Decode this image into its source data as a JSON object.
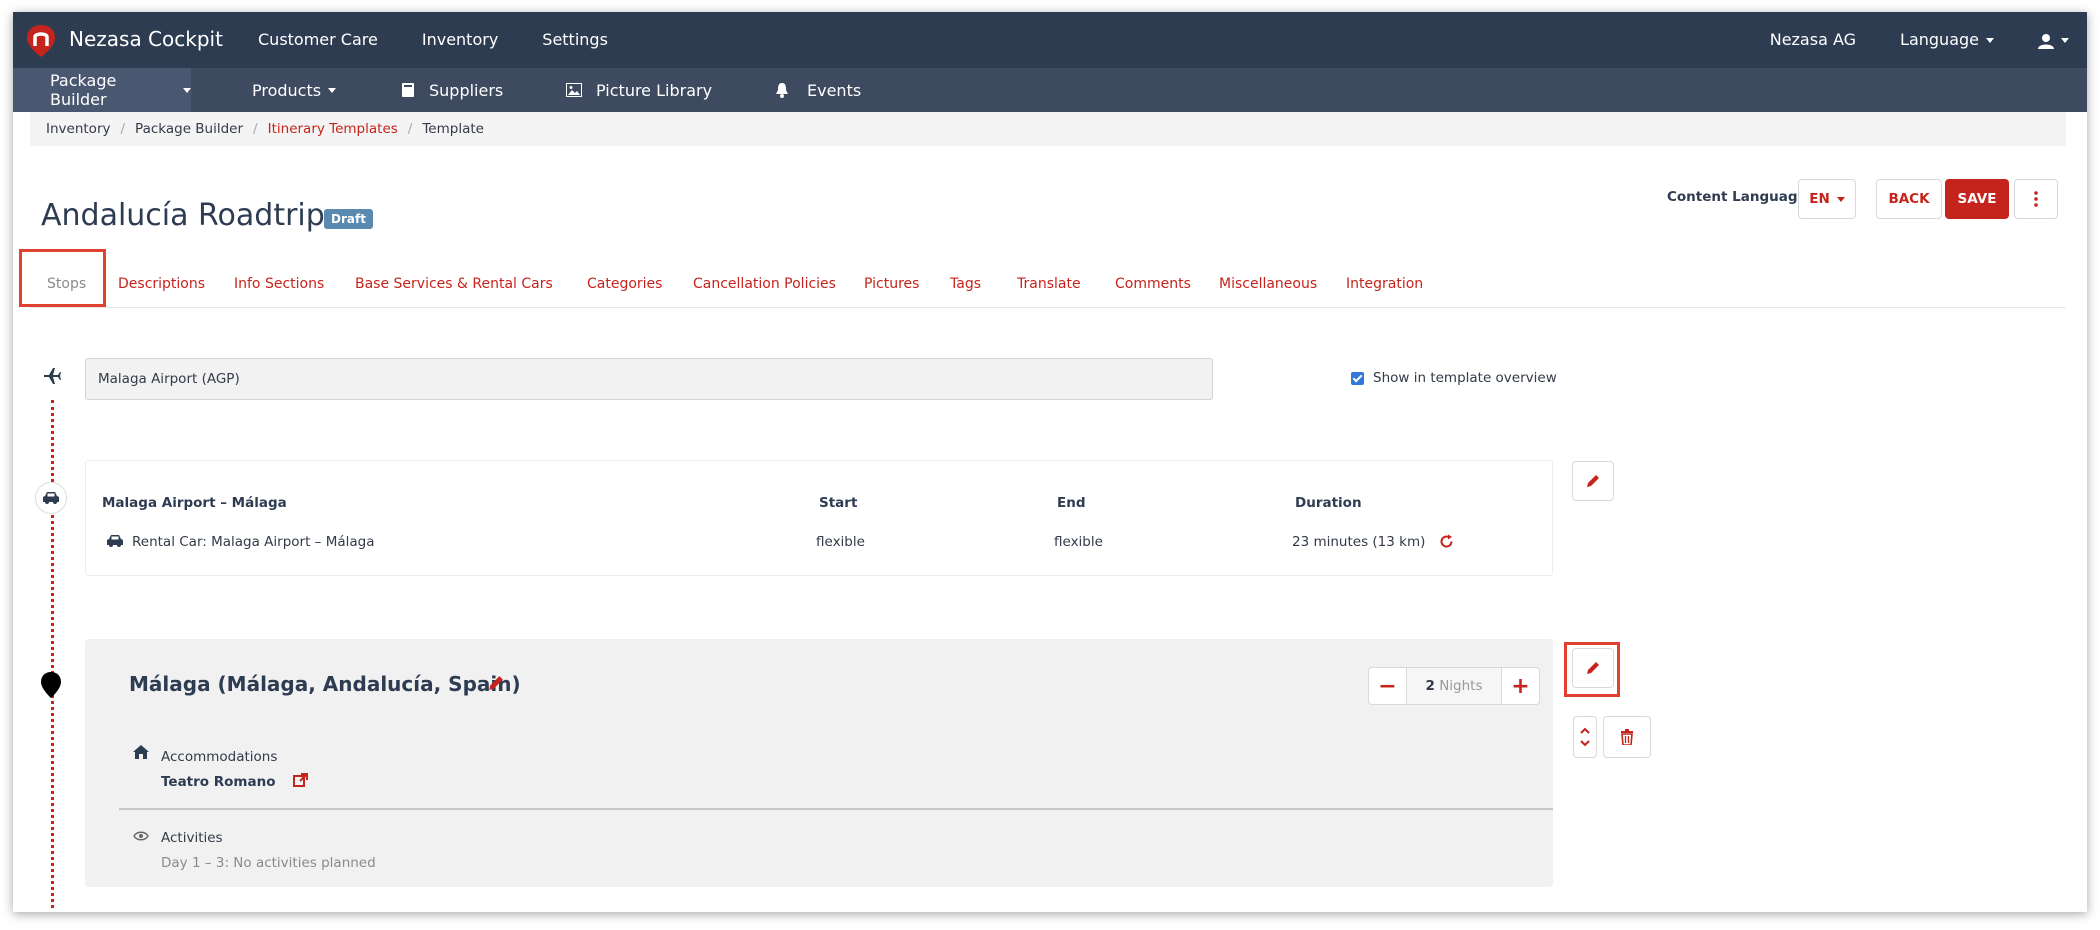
{
  "app": {
    "brand": "Nezasa Cockpit"
  },
  "top_nav": {
    "items": [
      "Customer Care",
      "Inventory",
      "Settings"
    ]
  },
  "top_right": {
    "company": "Nezasa AG",
    "language": "Language"
  },
  "sub_nav": {
    "items": [
      "Package Builder",
      "Products",
      "Suppliers",
      "Picture Library",
      "Events"
    ]
  },
  "breadcrumb": {
    "items": [
      "Inventory",
      "Package Builder",
      "Itinerary Templates",
      "Template"
    ]
  },
  "header": {
    "title": "Andalucía Roadtrip",
    "status": "Draft",
    "content_language_label": "Content Language",
    "language_value": "EN",
    "back_label": "BACK",
    "save_label": "SAVE"
  },
  "tabs": [
    "Stops",
    "Descriptions",
    "Info Sections",
    "Base Services & Rental Cars",
    "Categories",
    "Cancellation Policies",
    "Pictures",
    "Tags",
    "Translate",
    "Comments",
    "Miscellaneous",
    "Integration"
  ],
  "origin": {
    "value": "Malaga Airport (AGP)",
    "show_in_overview_label": "Show in template overview",
    "show_in_overview_checked": true
  },
  "transfer": {
    "route": "Malaga Airport  – Málaga",
    "col_start": "Start",
    "col_end": "End",
    "col_duration": "Duration",
    "service": "Rental Car: Malaga Airport  – Málaga",
    "start": "flexible",
    "end": "flexible",
    "duration": "23 minutes (13 km)"
  },
  "stop": {
    "title": "Málaga (Málaga, Andalucía, Spain)",
    "nights_value": "2",
    "nights_label": "Nights",
    "accommodations_label": "Accommodations",
    "accommodation_name": "Teatro Romano",
    "activities_label": "Activities",
    "activities_text": "Day 1 – 3: No activities planned"
  },
  "colors": {
    "accent": "#c5241c",
    "navbar": "#2e3c52",
    "subnav": "#3d4a5f",
    "badge": "#5a8ab0",
    "highlight": "#e0402f"
  }
}
